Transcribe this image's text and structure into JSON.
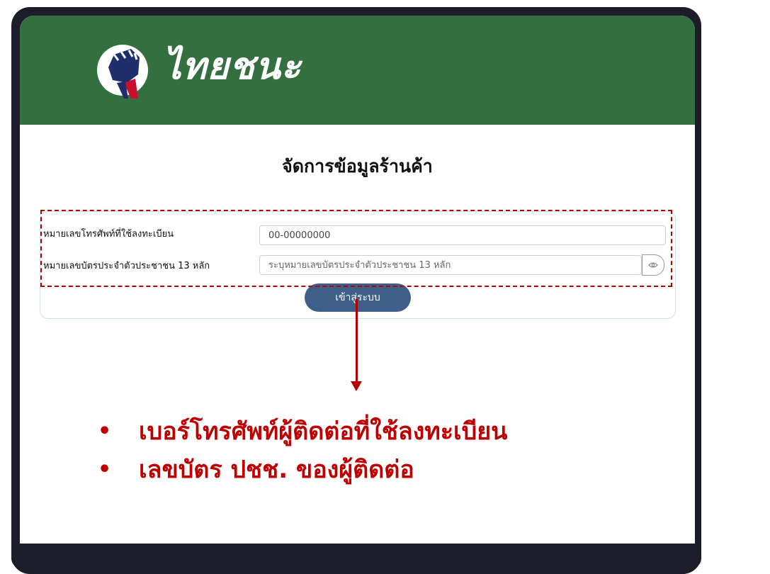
{
  "brand": {
    "name": "ไทยชนะ",
    "header_color": "#346f3f",
    "logo_icon": "raised-fist-icon"
  },
  "page": {
    "title": "จัดการข้อมูลร้านค้า"
  },
  "form": {
    "phone_label": "หมายเลขโทรศัพท์ที่ใช้ลงทะเบียน",
    "phone_value": "00-00000000",
    "id_label": "หมายเลขบัตรประจำตัวประชาชน 13 หลัก",
    "id_placeholder": "ระบุหมายเลขบัตรประจำตัวประชาชน 13 หลัก",
    "toggle_icon": "eye-icon",
    "login_label": "เข้าสู่ระบบ",
    "login_color": "#3e5f88"
  },
  "annotation": {
    "color": "#b40000",
    "bullets": [
      "เบอร์โทรศัพท์ผู้ติดต่อที่ใช้ลงทะเบียน",
      "เลขบัตร  ปชช. ของผู้ติดต่อ"
    ]
  }
}
